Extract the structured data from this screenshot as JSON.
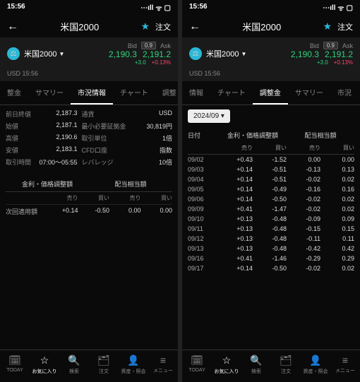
{
  "status": {
    "time": "15:56",
    "signal": "⋯ıll",
    "wifi": "ᯤ",
    "battery": "▢"
  },
  "header": {
    "title": "米国2000",
    "order": "注文"
  },
  "ticker": {
    "name": "米国2000",
    "sub": "USD 15:56",
    "bid_lbl": "Bid",
    "ask_lbl": "Ask",
    "spread": "0.9",
    "bid": "2,190.3",
    "ask": "2,191.2",
    "chg1": "+3.0",
    "chg2": "+0.13%"
  },
  "tabs_left": [
    "整金",
    "サマリー",
    "市況情報",
    "チャート",
    "調整"
  ],
  "tabs_right": [
    "情報",
    "チャート",
    "調整金",
    "サマリー",
    "市況"
  ],
  "info": [
    [
      "前日終値",
      "2,187.3",
      "通貨",
      "USD"
    ],
    [
      "始値",
      "2,187.1",
      "最小必要証拠金",
      "30,819円"
    ],
    [
      "高値",
      "2,190.6",
      "取引単位",
      "1倍"
    ],
    [
      "安値",
      "2,183.1",
      "CFD口座",
      "指数"
    ],
    [
      "取引時間",
      "07:00～05:55",
      "レバレッジ",
      "10倍"
    ]
  ],
  "sec1": "金利・価格調整額",
  "sec2": "配当相当額",
  "sub": [
    "",
    "売り",
    "買い",
    "売り",
    "買い"
  ],
  "next_label": "次回適用額",
  "next": [
    "+0.14",
    "-0.50",
    "0.00",
    "0.00"
  ],
  "month": "2024/09 ▾",
  "adj_h": [
    "日付",
    "売り",
    "買い",
    "売り",
    "買い"
  ],
  "adj": [
    [
      "09/02",
      "+0.43",
      "-1.52",
      "0.00",
      "0.00"
    ],
    [
      "09/03",
      "+0.14",
      "-0.51",
      "-0.13",
      "0.13"
    ],
    [
      "09/04",
      "+0.14",
      "-0.51",
      "-0.02",
      "0.02"
    ],
    [
      "09/05",
      "+0.14",
      "-0.49",
      "-0.16",
      "0.16"
    ],
    [
      "09/06",
      "+0.14",
      "-0.50",
      "-0.02",
      "0.02"
    ],
    [
      "09/09",
      "+0.41",
      "-1.47",
      "-0.02",
      "0.02"
    ],
    [
      "09/10",
      "+0.13",
      "-0.48",
      "-0.09",
      "0.09"
    ],
    [
      "09/11",
      "+0.13",
      "-0.48",
      "-0.15",
      "0.15"
    ],
    [
      "09/12",
      "+0.13",
      "-0.48",
      "-0.11",
      "0.11"
    ],
    [
      "09/13",
      "+0.13",
      "-0.48",
      "-0.42",
      "0.42"
    ],
    [
      "09/16",
      "+0.41",
      "-1.46",
      "-0.29",
      "0.29"
    ],
    [
      "09/17",
      "+0.14",
      "-0.50",
      "-0.02",
      "0.02"
    ]
  ],
  "nav": [
    [
      "TODAY",
      "🗓"
    ],
    [
      "お気に入り",
      "☆"
    ],
    [
      "検索",
      "🔍"
    ],
    [
      "注文",
      "🗂"
    ],
    [
      "資産・照会",
      "👤"
    ],
    [
      "メニュー",
      "≡"
    ]
  ]
}
